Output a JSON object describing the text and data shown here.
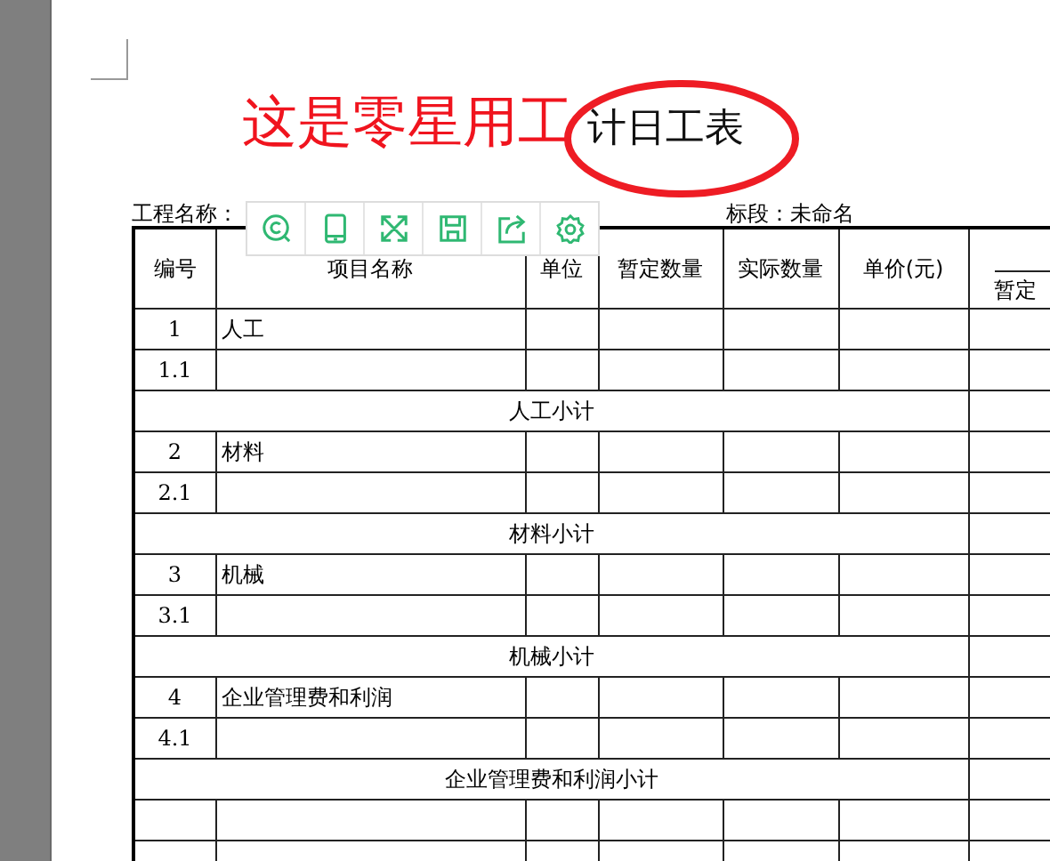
{
  "title": {
    "annotation": "这是零星用工",
    "text": "计日工表"
  },
  "project_label": "工程名称：",
  "section_label": "标段：未命名",
  "toolbar": [
    {
      "kind": "search"
    },
    {
      "kind": "tablet"
    },
    {
      "kind": "fullscreen"
    },
    {
      "kind": "save"
    },
    {
      "kind": "share"
    },
    {
      "kind": "settings"
    }
  ],
  "table": {
    "columns": [
      "编号",
      "项目名称",
      "单位",
      "暂定数量",
      "实际数量",
      "单价(元)"
    ],
    "column_7": "暂定",
    "rows": [
      {
        "kind": "item",
        "no": "1",
        "name": "人工"
      },
      {
        "kind": "item",
        "no": "1.1"
      },
      {
        "kind": "subtotal",
        "label": "人工小计"
      },
      {
        "kind": "item",
        "no": "2",
        "name": "材料"
      },
      {
        "kind": "item",
        "no": "2.1"
      },
      {
        "kind": "subtotal",
        "label": "材料小计"
      },
      {
        "kind": "item",
        "no": "3",
        "name": "机械"
      },
      {
        "kind": "item",
        "no": "3.1"
      },
      {
        "kind": "subtotal",
        "label": "机械小计"
      },
      {
        "kind": "item",
        "no": "4",
        "name": "企业管理费和利润"
      },
      {
        "kind": "item",
        "no": "4.1"
      },
      {
        "kind": "subtotal",
        "label": "企业管理费和利润小计"
      },
      {
        "kind": "item"
      },
      {
        "kind": "item"
      }
    ]
  }
}
